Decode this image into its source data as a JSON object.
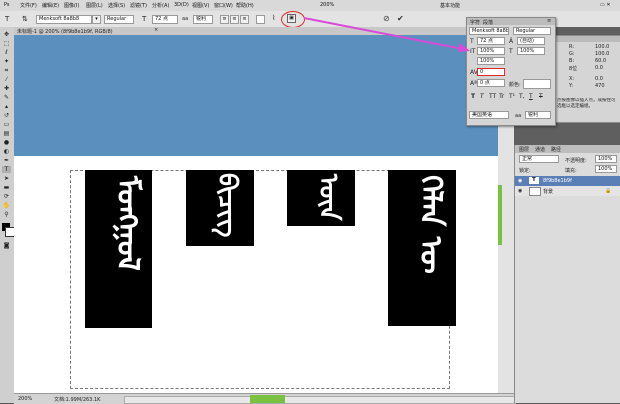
{
  "menubar": {
    "items": [
      "文件(F)",
      "编辑(E)",
      "图像(I)",
      "图层(L)",
      "选择(S)",
      "滤镜(T)",
      "分析(A)",
      "3D(D)",
      "视图(V)",
      "窗口(W)",
      "帮助(H)"
    ],
    "zoom": "200%",
    "right_label": "基本功能"
  },
  "options": {
    "tool_icon": "T",
    "font_family": "Menksoft 8a8b8",
    "font_style": "Regular",
    "font_size": "72 点",
    "antialias": "锐利",
    "ok_icon": "check-icon",
    "cancel_icon": "cancel-icon"
  },
  "document_tab": {
    "title": "未标题-1 @ 200% (8f9b8e1b9f, RGB/8)"
  },
  "statusbar": {
    "zoom": "200%",
    "doc_info": "文档:1.99M/263.1K"
  },
  "character_panel": {
    "tabs": [
      "字符",
      "段落"
    ],
    "font_family": "Menksoft 8a8b8",
    "font_style": "Regular",
    "font_size": "72 点",
    "leading": "(自动)",
    "vertical_scale": "100%",
    "horizontal_scale": "100%",
    "tracking": "0",
    "baseline_scale": "100%",
    "baseline_shift": "0 点",
    "color_label": "颜色:",
    "language": "美国英语",
    "antialias": "锐利",
    "style_buttons": [
      "T",
      "T",
      "TT",
      "Tr",
      "T¹",
      "T,",
      "T",
      "T"
    ]
  },
  "info_panel": {
    "values": [
      "R:",
      "G:",
      "B:",
      "8位",
      "X:",
      "Y:"
    ],
    "numbers": [
      "100.0",
      "100.0",
      "60.0",
      "0.0",
      "0.0",
      "470"
    ],
    "hint": "点按图像以插入点，或按住可选框以选定编组。"
  },
  "layers_panel": {
    "tabs": [
      "图层",
      "通道",
      "路径"
    ],
    "blend_mode": "正常",
    "opacity_label": "不透明度:",
    "opacity": "100%",
    "lock_label": "锁定:",
    "fill_label": "填充:",
    "fill": "100%",
    "layers": [
      {
        "name": "8f9b8e1b9f",
        "type": "text",
        "selected": true
      },
      {
        "name": "背景",
        "type": "background",
        "selected": false
      }
    ]
  },
  "colors": {
    "blue_band": "#5b8fbe",
    "highlight_pink": "#d84ad8"
  }
}
